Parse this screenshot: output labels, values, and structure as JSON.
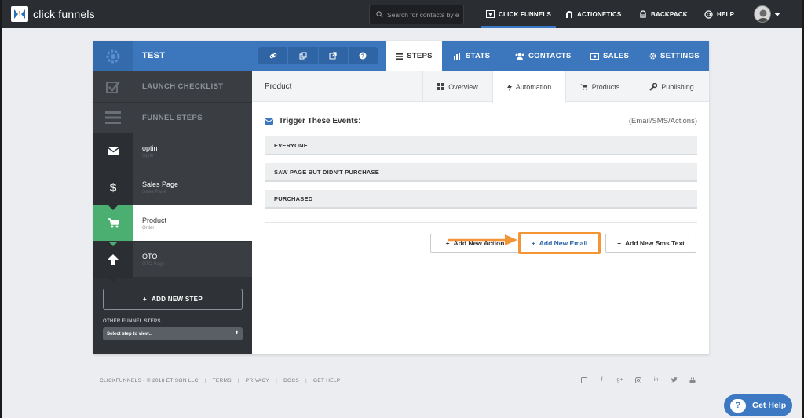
{
  "topbar": {
    "logo_text": "click funnels",
    "search_placeholder": "Search for contacts by e",
    "nav": [
      {
        "label": "CLICK FUNNELS",
        "active": true
      },
      {
        "label": "ACTIONETICS",
        "active": false
      },
      {
        "label": "BACKPACK",
        "active": false
      },
      {
        "label": "HELP",
        "active": false
      }
    ]
  },
  "funnel": {
    "name": "TEST",
    "tabs": [
      {
        "label": "STEPS",
        "active": true
      },
      {
        "label": "STATS",
        "active": false
      },
      {
        "label": "CONTACTS",
        "active": false
      },
      {
        "label": "SALES",
        "active": false
      },
      {
        "label": "SETTINGS",
        "active": false
      }
    ]
  },
  "sidebar": {
    "launch_checklist": "LAUNCH CHECKLIST",
    "funnel_steps": "FUNNEL STEPS",
    "steps": [
      {
        "name": "optin",
        "sub": "Optin",
        "icon": "envelope-icon",
        "active": false
      },
      {
        "name": "Sales Page",
        "sub": "Sales Page",
        "icon": "dollar-icon",
        "active": false
      },
      {
        "name": "Product",
        "sub": "Order",
        "icon": "cart-icon",
        "active": true
      },
      {
        "name": "OTO",
        "sub": "OTO Page",
        "icon": "arrow-up-icon",
        "active": false
      }
    ],
    "add_new_step": "ADD NEW STEP",
    "other_funnel_steps": "OTHER FUNNEL STEPS",
    "select_placeholder": "Select step to view..."
  },
  "main": {
    "page_name": "Product",
    "subtabs": [
      {
        "label": "Overview",
        "active": false
      },
      {
        "label": "Automation",
        "active": true
      },
      {
        "label": "Products",
        "active": false
      },
      {
        "label": "Publishing",
        "active": false
      }
    ],
    "trigger_title": "Trigger These Events:",
    "trigger_right": "(Email/SMS/Actions)",
    "events": [
      "EVERYONE",
      "SAW PAGE BUT DIDN'T PURCHASE",
      "PURCHASED"
    ],
    "buttons": {
      "add_action": "Add New Action",
      "add_email": "Add New Email",
      "add_sms": "Add New Sms Text"
    }
  },
  "footer": {
    "copyright": "CLICKFUNNELS - © 2018 ETISON LLC",
    "links": [
      "TERMS",
      "PRIVACY",
      "DOCS",
      "GET HELP"
    ]
  },
  "help_button": "Get Help",
  "colors": {
    "brand_blue": "#3c77bd",
    "highlight_orange": "#f39534",
    "active_step_green": "#4caf72"
  }
}
